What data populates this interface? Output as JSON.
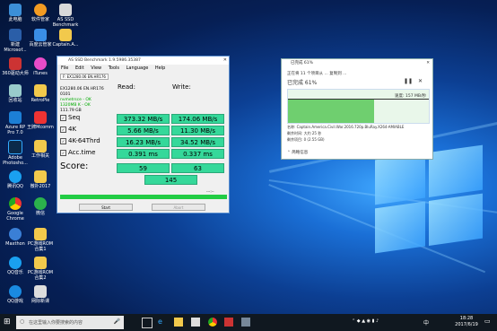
{
  "desktop": {
    "icons": [
      {
        "label": "此电脑"
      },
      {
        "label": "软件管家"
      },
      {
        "label": "AS SSD Benchmark"
      },
      {
        "label": "新建 Microsof..."
      },
      {
        "label": "百度云管家"
      },
      {
        "label": "Captain.A..."
      },
      {
        "label": "360驱动大师"
      },
      {
        "label": "iTunes"
      },
      {
        "label": "回收站"
      },
      {
        "label": "RetroPie"
      },
      {
        "label": "Azure RP Pro 7.0"
      },
      {
        "label": "王牌Mcomm"
      },
      {
        "label": "Adobe Photosho..."
      },
      {
        "label": "工作相关"
      },
      {
        "label": "腾讯QQ"
      },
      {
        "label": "微扑2017"
      },
      {
        "label": "Google Chrome"
      },
      {
        "label": "微信"
      },
      {
        "label": "Maxthon"
      },
      {
        "label": "PC游戏ROM合集1"
      },
      {
        "label": "QQ音乐"
      },
      {
        "label": "PC游戏ROM合集2"
      },
      {
        "label": "QQ游戏"
      },
      {
        "label": "网际新课"
      }
    ]
  },
  "asssd": {
    "title": "AS SSD Benchmark 1.9.5986.35387",
    "menu": [
      "File",
      "Edit",
      "View",
      "Tools",
      "Language",
      "Help"
    ],
    "drive_select": "F: EX1280.06 EN.HR176",
    "info": [
      "EX1280.06 EN.HR176",
      "0101",
      "nvmetrsce - OK",
      "1320MB K - OK",
      "111.79 GB"
    ],
    "header_read": "Read:",
    "header_write": "Write:",
    "rows": [
      {
        "label": "Seq",
        "read": "373.32 MB/s",
        "write": "174.06 MB/s"
      },
      {
        "label": "4K",
        "read": "5.66 MB/s",
        "write": "11.30 MB/s"
      },
      {
        "label": "4K-64Thrd",
        "read": "16.23 MB/s",
        "write": "34.52 MB/s"
      },
      {
        "label": "Acc.time",
        "read": "0.391 ms",
        "write": "0.337 ms"
      }
    ],
    "score_label": "Score:",
    "score_read": "59",
    "score_write": "63",
    "score_total": "145",
    "progress_percent": 100,
    "start_label": "Start",
    "abort_label": "Abort",
    "timer": "---:--"
  },
  "copy": {
    "title": "已完成 61%",
    "from_line": "正在将 11 个项目从 ... 复制到 ...",
    "percent_label": "已完成 61%",
    "speed": "速度: 157 MB/秒",
    "name": "名称: Captain.America.Civil.War.2016.720p.BluRay.X264-AMIABLE",
    "time_left": "剩余时间: 大约 25 秒",
    "items_left": "剩余项目: 0 (2.55 GB)",
    "less_details": "简略信息",
    "progress": 0.61
  },
  "taskbar": {
    "search_placeholder": "在这里输入你要搜索的内容",
    "time": "18:28",
    "date": "2017/6/19",
    "lang": "中"
  }
}
